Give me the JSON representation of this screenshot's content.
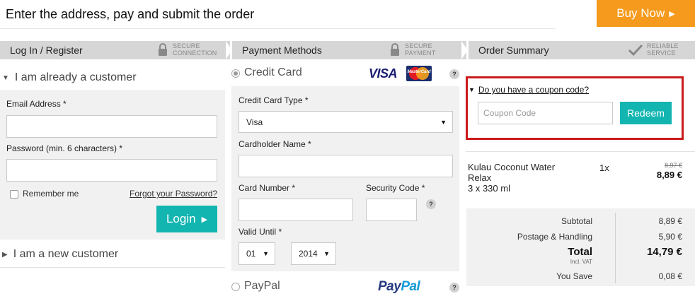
{
  "header": {
    "title": "Enter the address, pay and submit the order",
    "buy_now": "Buy Now"
  },
  "steps": [
    {
      "label": "Log In / Register",
      "badge_line1": "SECURE",
      "badge_line2": "CONNECTION",
      "icon": "lock-icon"
    },
    {
      "label": "Payment Methods",
      "badge_line1": "SECURE",
      "badge_line2": "PAYMENT",
      "icon": "lock-icon"
    },
    {
      "label": "Order Summary",
      "badge_line1": "RELIABLE",
      "badge_line2": "SERVICE",
      "icon": "checkmark-icon"
    }
  ],
  "login": {
    "existing_customer": "I am already a customer",
    "email_label": "Email Address *",
    "email_value": "",
    "password_label": "Password (min. 6 characters) *",
    "password_value": "",
    "remember_me": "Remember me",
    "forgot_password": "Forgot your Password?",
    "login_button": "Login",
    "new_customer": "I am a new customer"
  },
  "payment": {
    "credit_card_label": "Credit Card",
    "card_type_label": "Credit Card Type *",
    "card_type_value": "Visa",
    "cardholder_label": "Cardholder Name *",
    "cardholder_value": "",
    "card_number_label": "Card Number *",
    "security_code_label": "Security Code *",
    "valid_until_label": "Valid Until  *",
    "month_value": "01",
    "year_value": "2014",
    "paypal_label": "PayPal",
    "visa_logo": "VISA",
    "mastercard_logo": "MasterCard",
    "paypal_logo_pay": "Pay",
    "paypal_logo_pal": "Pal",
    "help": "?"
  },
  "summary": {
    "coupon_toggle": "Do you have a coupon code?",
    "coupon_placeholder": "Coupon Code",
    "redeem": "Redeem",
    "item": {
      "name_line1": "Kulau Coconut Water",
      "name_line2": "Relax",
      "size": "3 x 330 ml",
      "qty": "1x",
      "old_price": "8,97 €",
      "price": "8,89 €"
    },
    "subtotal_label": "Subtotal",
    "subtotal_value": "8,89 €",
    "shipping_label": "Postage & Handling",
    "shipping_value": "5,90 €",
    "total_label": "Total",
    "total_sub": "Incl. VAT",
    "total_value": "14,79 €",
    "save_label": "You Save",
    "save_value": "0,08 €"
  },
  "colors": {
    "accent_teal": "#13b5b1",
    "buy_orange": "#f59a1c",
    "coupon_border": "#cc1a1a"
  }
}
